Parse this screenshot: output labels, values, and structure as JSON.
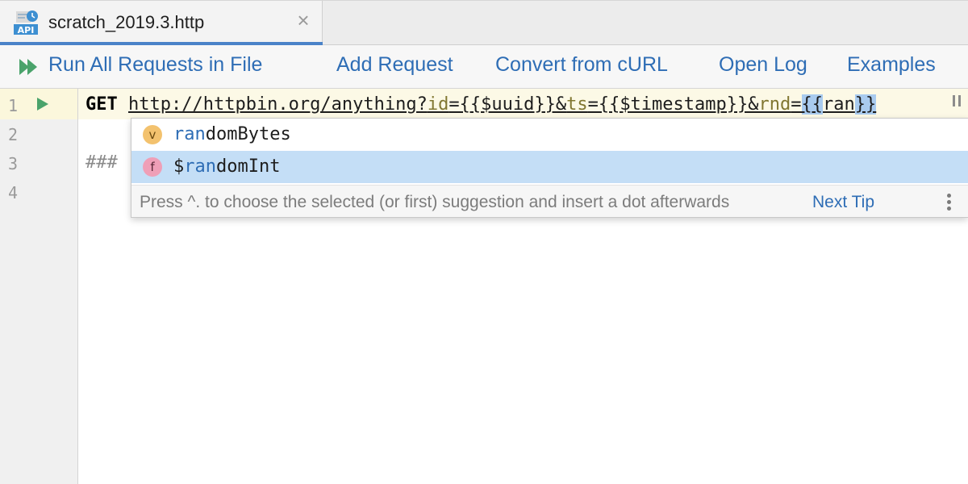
{
  "tab": {
    "icon_label": "API",
    "title": "scratch_2019.3.http",
    "close_glyph": "×"
  },
  "toolbar": {
    "run_all": "Run All Requests in File",
    "add_request": "Add Request",
    "convert": "Convert from cURL",
    "open_log": "Open Log",
    "examples": "Examples"
  },
  "editor": {
    "line_numbers": [
      "1",
      "2",
      "3",
      "4"
    ],
    "line1": {
      "method": "GET",
      "url_base": "http://httpbin.org/anything?",
      "p1_name": "id",
      "p1_value": "={{$uuid}}&",
      "p2_name": "ts",
      "p2_value": "={{$timestamp}}&",
      "p3_name": "rnd",
      "p3_eq": "=",
      "open_braces": "{{",
      "typed": "ran",
      "close_braces": "}}"
    },
    "line3": "###"
  },
  "completion": {
    "items": [
      {
        "badge": "v",
        "match": "ran",
        "prefix": "",
        "rest": "domBytes"
      },
      {
        "badge": "f",
        "match": "ran",
        "prefix": "$",
        "rest": "domInt"
      }
    ],
    "hint": "Press ^. to choose the selected (or first) suggestion and insert a dot afterwards",
    "next_tip": "Next Tip"
  },
  "colors": {
    "accent": "#2e6db5",
    "selection": "#c4def6",
    "param": "#817732"
  }
}
